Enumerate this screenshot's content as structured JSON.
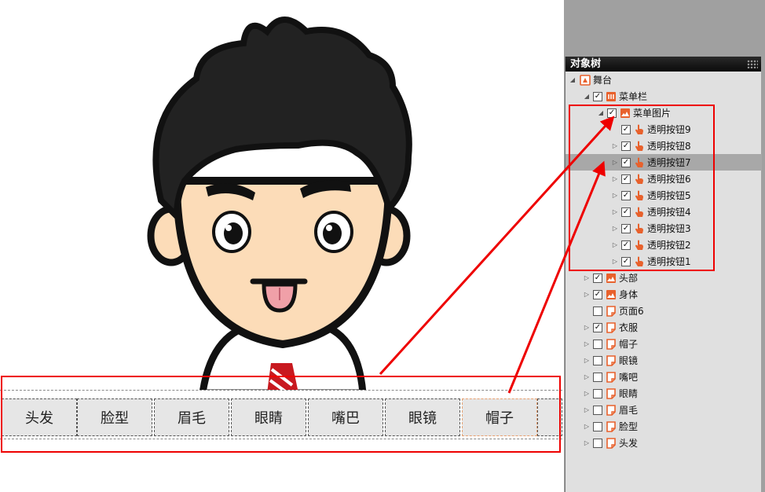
{
  "panel": {
    "title": "对象树"
  },
  "menu": {
    "buttons": [
      {
        "label": "头发"
      },
      {
        "label": "脸型"
      },
      {
        "label": "眉毛"
      },
      {
        "label": "眼睛"
      },
      {
        "label": "嘴巴"
      },
      {
        "label": "眼镜"
      },
      {
        "label": "帽子"
      }
    ]
  },
  "tree": {
    "nodes": [
      {
        "label": "舞台",
        "level": 0,
        "twisty": "open",
        "checkbox": "none",
        "icon": "stage-icon"
      },
      {
        "label": "菜单栏",
        "level": 1,
        "twisty": "open",
        "checkbox": "checked",
        "icon": "menubar-icon"
      },
      {
        "label": "菜单图片",
        "level": 2,
        "twisty": "open",
        "checkbox": "checked",
        "icon": "image-icon"
      },
      {
        "label": "透明按钮9",
        "level": 3,
        "twisty": "none",
        "checkbox": "checked",
        "icon": "hand-icon"
      },
      {
        "label": "透明按钮8",
        "level": 3,
        "twisty": "closed",
        "checkbox": "checked",
        "icon": "hand-icon"
      },
      {
        "label": "透明按钮7",
        "level": 3,
        "twisty": "closed",
        "checkbox": "checked",
        "icon": "hand-icon",
        "selected": true
      },
      {
        "label": "透明按钮6",
        "level": 3,
        "twisty": "closed",
        "checkbox": "checked",
        "icon": "hand-icon"
      },
      {
        "label": "透明按钮5",
        "level": 3,
        "twisty": "closed",
        "checkbox": "checked",
        "icon": "hand-icon"
      },
      {
        "label": "透明按钮4",
        "level": 3,
        "twisty": "closed",
        "checkbox": "checked",
        "icon": "hand-icon"
      },
      {
        "label": "透明按钮3",
        "level": 3,
        "twisty": "closed",
        "checkbox": "checked",
        "icon": "hand-icon"
      },
      {
        "label": "透明按钮2",
        "level": 3,
        "twisty": "closed",
        "checkbox": "checked",
        "icon": "hand-icon"
      },
      {
        "label": "透明按钮1",
        "level": 3,
        "twisty": "closed",
        "checkbox": "checked",
        "icon": "hand-icon"
      },
      {
        "label": "头部",
        "level": 1,
        "twisty": "closed",
        "checkbox": "checked",
        "icon": "image-icon"
      },
      {
        "label": "身体",
        "level": 1,
        "twisty": "closed",
        "checkbox": "checked",
        "icon": "image-icon"
      },
      {
        "label": "页面6",
        "level": 1,
        "twisty": "none",
        "checkbox": "unchecked",
        "icon": "page-icon"
      },
      {
        "label": "衣服",
        "level": 1,
        "twisty": "closed",
        "checkbox": "checked",
        "icon": "page-icon"
      },
      {
        "label": "帽子",
        "level": 1,
        "twisty": "closed",
        "checkbox": "unchecked",
        "icon": "page-icon"
      },
      {
        "label": "眼镜",
        "level": 1,
        "twisty": "closed",
        "checkbox": "unchecked",
        "icon": "page-icon"
      },
      {
        "label": "嘴吧",
        "level": 1,
        "twisty": "closed",
        "checkbox": "unchecked",
        "icon": "page-icon"
      },
      {
        "label": "眼睛",
        "level": 1,
        "twisty": "closed",
        "checkbox": "unchecked",
        "icon": "page-icon"
      },
      {
        "label": "眉毛",
        "level": 1,
        "twisty": "closed",
        "checkbox": "unchecked",
        "icon": "page-icon"
      },
      {
        "label": "脸型",
        "level": 1,
        "twisty": "closed",
        "checkbox": "unchecked",
        "icon": "page-icon"
      },
      {
        "label": "头发",
        "level": 1,
        "twisty": "closed",
        "checkbox": "unchecked",
        "icon": "page-icon"
      }
    ]
  },
  "colors": {
    "annotation": "#e00000",
    "icon_orange": "#e8612c",
    "panel_bg": "#e0e0e0"
  }
}
